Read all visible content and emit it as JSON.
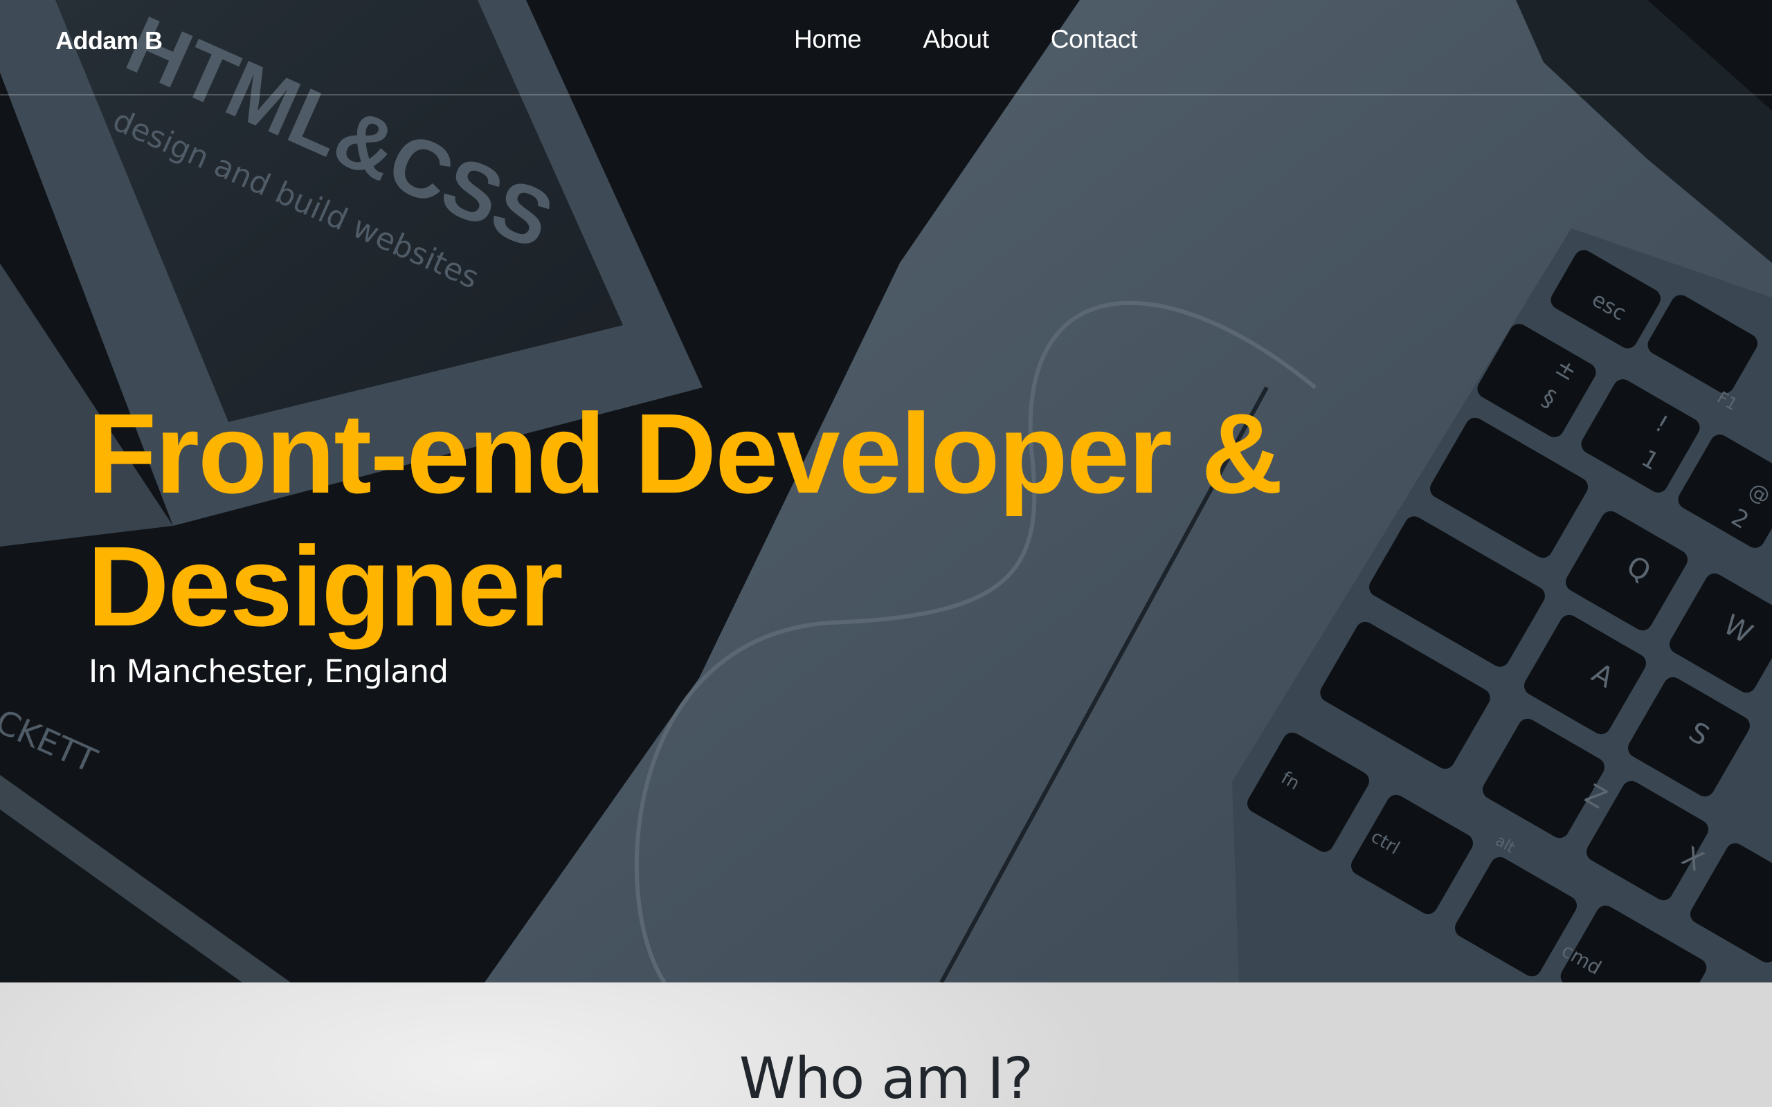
{
  "nav": {
    "brand": "Addam B",
    "links": [
      "Home",
      "About",
      "Contact"
    ]
  },
  "hero": {
    "headline": "Front-end Developer & Designer",
    "subline": "In Manchester, England",
    "background_book_title": "HTML&CSS",
    "background_book_subtitle": "design and build websites",
    "background_book_author_fragment": "CKETT",
    "background_keys": [
      "esc",
      "F1",
      "±",
      "§",
      "!",
      "1",
      "@",
      "2",
      "Q",
      "W",
      "A",
      "S",
      "Z",
      "X",
      "fn",
      "ctrl",
      "alt",
      "cmd"
    ]
  },
  "about": {
    "title": "Who am I?"
  },
  "colors": {
    "accent": "#ffb400",
    "hero_overlay": "#11161b",
    "laptop_blue_gray": "#4a5966",
    "about_bg": "#e4e4e4",
    "about_text": "#20262c"
  }
}
